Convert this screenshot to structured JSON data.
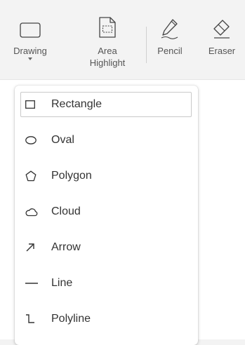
{
  "toolbar": {
    "tools": [
      {
        "label": "Drawing",
        "icon": "rectangle-shape-icon",
        "has_dropdown": true
      },
      {
        "label": "Area\nHighlight",
        "icon": "area-highlight-icon"
      },
      {
        "label": "Pencil",
        "icon": "pencil-icon"
      },
      {
        "label": "Eraser",
        "icon": "eraser-icon"
      }
    ]
  },
  "dropdown": {
    "selected": "Rectangle",
    "items": [
      {
        "label": "Rectangle",
        "icon": "rectangle-icon"
      },
      {
        "label": "Oval",
        "icon": "oval-icon"
      },
      {
        "label": "Polygon",
        "icon": "polygon-icon"
      },
      {
        "label": "Cloud",
        "icon": "cloud-icon"
      },
      {
        "label": "Arrow",
        "icon": "arrow-icon"
      },
      {
        "label": "Line",
        "icon": "line-icon"
      },
      {
        "label": "Polyline",
        "icon": "polyline-icon"
      }
    ]
  },
  "colors": {
    "toolbar_bg": "#f3f3f3",
    "menu_bg": "#ffffff",
    "text": "#333333",
    "selected_border": "#c9c9c9"
  }
}
